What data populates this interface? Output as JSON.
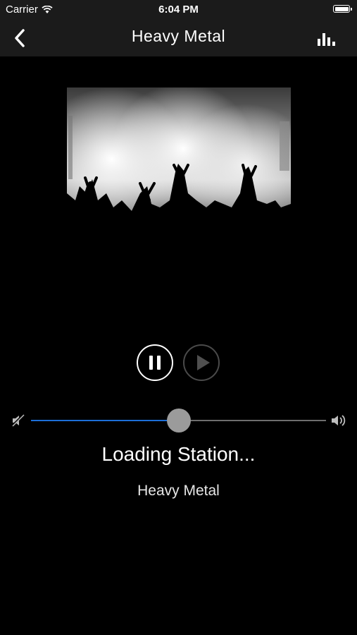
{
  "status_bar": {
    "carrier": "Carrier",
    "time": "6:04 PM"
  },
  "nav": {
    "title": "Heavy Metal",
    "back_icon": "chevron-left-icon",
    "right_icon": "equalizer-icon"
  },
  "player": {
    "album_art_description": "concert-crowd-image",
    "pause_icon": "pause-icon",
    "play_icon": "play-icon",
    "volume_level": 0.5,
    "volume_fill_color": "#1c6fd8",
    "status_text": "Loading Station...",
    "station_name": "Heavy Metal"
  }
}
